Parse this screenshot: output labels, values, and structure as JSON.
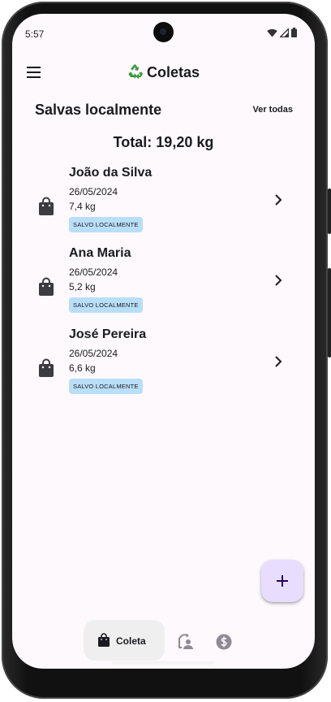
{
  "status_bar": {
    "time": "5:57",
    "icons": [
      "wifi-icon",
      "signal-icon",
      "battery-icon"
    ]
  },
  "app_bar": {
    "menu_icon": "menu-icon",
    "title_icon": "recycle-icon",
    "title": "Coletas"
  },
  "section": {
    "title": "Salvas localmente",
    "see_all_label": "Ver todas"
  },
  "total": "Total: 19,20 kg",
  "collections": [
    {
      "name": "João da Silva",
      "date": "26/05/2024",
      "weight": "7,4 kg",
      "badge": "SALVO LOCALMENTE",
      "icon": "shopping-bag-icon"
    },
    {
      "name": "Ana Maria",
      "date": "26/05/2024",
      "weight": "5,2 kg",
      "badge": "SALVO LOCALMENTE",
      "icon": "shopping-bag-icon"
    },
    {
      "name": "José Pereira",
      "date": "26/05/2024",
      "weight": "6,6 kg",
      "badge": "SALVO LOCALMENTE",
      "icon": "shopping-bag-icon"
    }
  ],
  "fab": {
    "icon": "plus-icon"
  },
  "bottom_nav": {
    "items": [
      {
        "label": "Coleta",
        "icon": "shopping-bag-icon",
        "active": true
      },
      {
        "label": "",
        "icon": "recycle-exchange-icon",
        "active": false
      },
      {
        "label": "",
        "icon": "dollar-coin-icon",
        "active": false
      }
    ]
  },
  "colors": {
    "background": "#fdf9fc",
    "badge": "#b9def8",
    "fab": "#e9ddff",
    "nav_active": "#efefef",
    "text": "#1b1b1f",
    "icon": "#3d3a40"
  }
}
